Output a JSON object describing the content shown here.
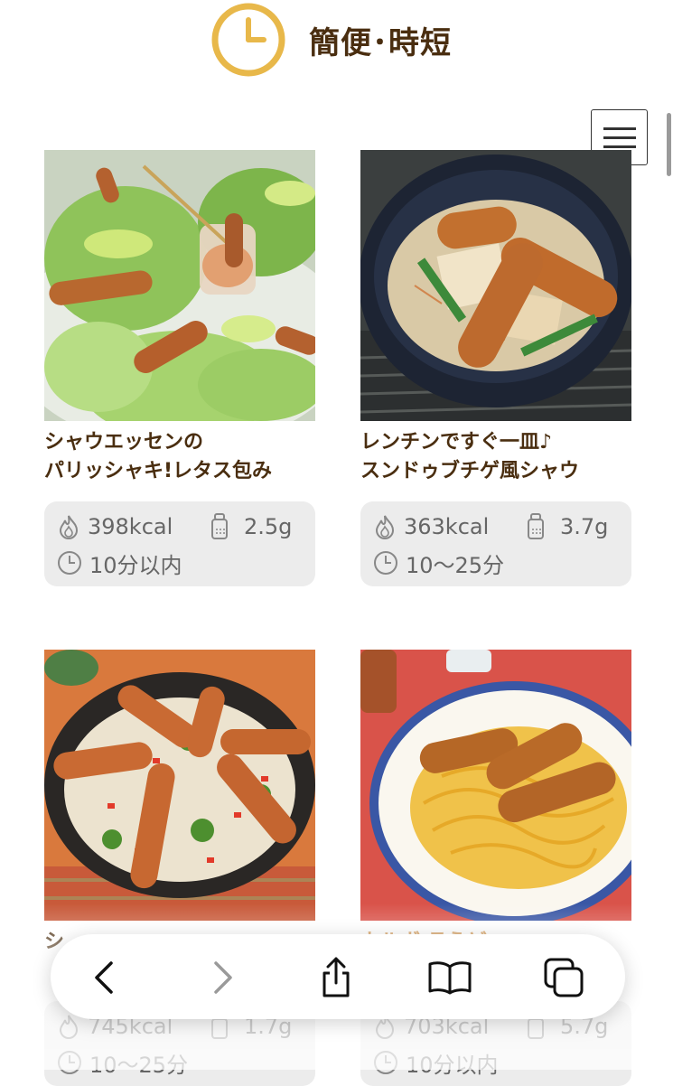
{
  "header": {
    "title": "簡便･時短",
    "icon": "clock-icon",
    "accent_color": "#E8B84A"
  },
  "menu": {
    "icon": "hamburger-menu-icon"
  },
  "recipes": [
    {
      "title": "シャウエッセンの\nパリッシャキ!レタス包み",
      "calories": "398kcal",
      "salt": "2.5g",
      "time": "10分以内"
    },
    {
      "title": "レンチンですぐ一皿♪\nスンドゥブチゲ風シャウ",
      "calories": "363kcal",
      "salt": "3.7g",
      "time": "10～25分"
    },
    {
      "title": "シ",
      "calories": "745kcal",
      "salt": "1.7g",
      "time": "10～25分"
    },
    {
      "title": "カルボ ラうど",
      "calories": "703kcal",
      "salt": "5.7g",
      "time": "10分以内"
    }
  ],
  "info_icons": {
    "calorie": "flame-icon",
    "salt": "salt-shaker-icon",
    "time": "clock-icon"
  },
  "toolbar": {
    "back": "back-chevron-icon",
    "forward": "forward-chevron-icon",
    "share": "share-icon",
    "bookmarks": "book-icon",
    "tabs": "tabs-icon"
  }
}
